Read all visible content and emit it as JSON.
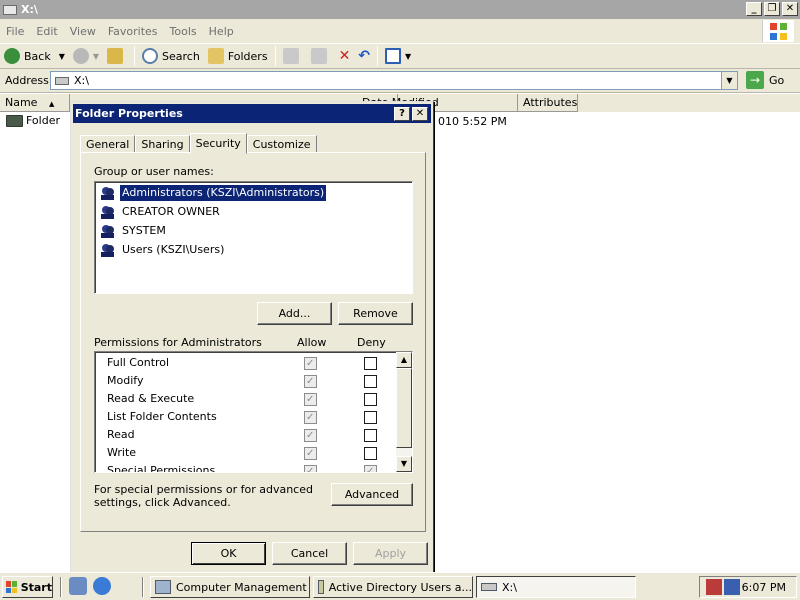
{
  "window": {
    "title": "X:\\",
    "minimize_label": "_",
    "restore_label": "❐",
    "close_label": "✕"
  },
  "menu": [
    "File",
    "Edit",
    "View",
    "Favorites",
    "Tools",
    "Help"
  ],
  "toolbar": {
    "back": "Back",
    "search": "Search",
    "folders": "Folders"
  },
  "address": {
    "label": "Address",
    "value": "X:\\",
    "go": "Go"
  },
  "columns": {
    "name": "Name",
    "modified": "Date Modified",
    "attributes": "Attributes"
  },
  "files": [
    {
      "name": "Folder",
      "modified_visible": "010 5:52 PM"
    }
  ],
  "dialog": {
    "title": "Folder Properties",
    "help_label": "?",
    "close_label": "✕",
    "tabs": [
      "General",
      "Sharing",
      "Security",
      "Customize"
    ],
    "active_tab": "Security",
    "group_label": "Group or user names:",
    "users": [
      "Administrators (KSZI\\Administrators)",
      "CREATOR OWNER",
      "SYSTEM",
      "Users (KSZI\\Users)"
    ],
    "add_button": "Add...",
    "remove_button": "Remove",
    "permissions_label": "Permissions for Administrators",
    "allow_label": "Allow",
    "deny_label": "Deny",
    "permissions": [
      {
        "name": "Full Control",
        "allow": true,
        "deny": false
      },
      {
        "name": "Modify",
        "allow": true,
        "deny": false
      },
      {
        "name": "Read & Execute",
        "allow": true,
        "deny": false
      },
      {
        "name": "List Folder Contents",
        "allow": true,
        "deny": false
      },
      {
        "name": "Read",
        "allow": true,
        "deny": false
      },
      {
        "name": "Write",
        "allow": true,
        "deny": false
      },
      {
        "name": "Special Permissions",
        "allow": false,
        "deny": false
      }
    ],
    "advanced_text": "For special permissions or for advanced settings, click Advanced.",
    "advanced_button": "Advanced",
    "ok": "OK",
    "cancel": "Cancel",
    "apply": "Apply"
  },
  "taskbar": {
    "start": "Start",
    "tasks": [
      "Computer Management",
      "Active Directory Users a...",
      "X:\\"
    ],
    "time": "6:07 PM"
  },
  "colors": {
    "dialog_title_bg": "#0b2475",
    "window_title_bg": "#a6a6a6",
    "face": "#ece9d8",
    "selection": "#0b2475"
  }
}
